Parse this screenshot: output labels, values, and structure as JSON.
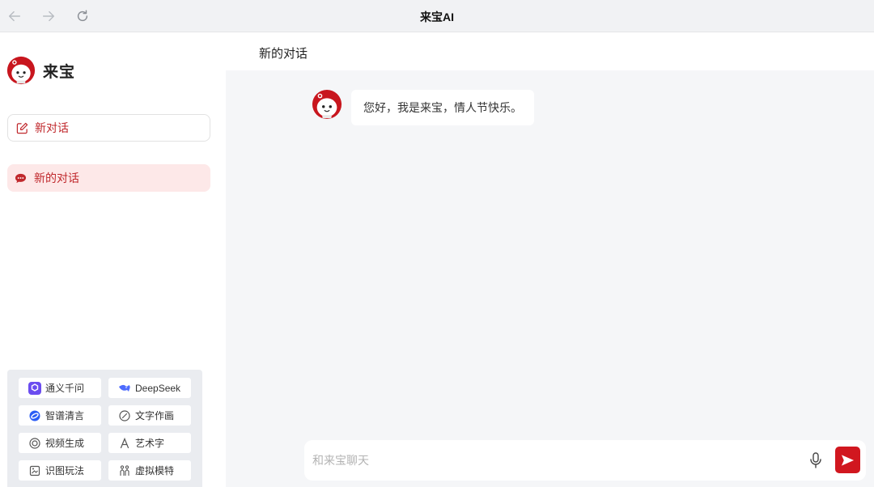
{
  "window": {
    "title": "来宝AI",
    "back_icon": "arrow-left-icon",
    "forward_icon": "arrow-right-icon",
    "reload_icon": "reload-icon"
  },
  "sidebar": {
    "brand_name": "来宝",
    "brand_icon": "mascot-avatar",
    "new_chat_label": "新对话",
    "new_chat_icon": "edit-icon",
    "conversations": [
      {
        "label": "新的对话",
        "icon": "chat-bubble-icon",
        "active": true
      }
    ],
    "tools": [
      {
        "label": "通义千问",
        "icon": "tongyi-logo-icon"
      },
      {
        "label": "DeepSeek",
        "icon": "deepseek-whale-icon"
      },
      {
        "label": "智谱清言",
        "icon": "zhipu-logo-icon"
      },
      {
        "label": "文字作画",
        "icon": "brush-icon"
      },
      {
        "label": "视频生成",
        "icon": "video-circle-icon"
      },
      {
        "label": "艺术字",
        "icon": "font-a-icon"
      },
      {
        "label": "识图玩法",
        "icon": "image-scan-icon"
      },
      {
        "label": "虚拟模特",
        "icon": "model-people-icon"
      }
    ]
  },
  "main": {
    "title": "新的对话",
    "messages": [
      {
        "role": "assistant",
        "text": "您好，我是来宝，情人节快乐。"
      }
    ],
    "input": {
      "placeholder": "和来宝聊天",
      "value": ""
    },
    "mic_icon": "microphone-icon",
    "send_icon": "send-icon"
  },
  "colors": {
    "accent": "#c0282c",
    "send_button": "#d1171f",
    "active_item_bg": "#fde8e8",
    "main_bg": "#f5f6f8",
    "tools_panel_bg": "#eaecf0"
  }
}
